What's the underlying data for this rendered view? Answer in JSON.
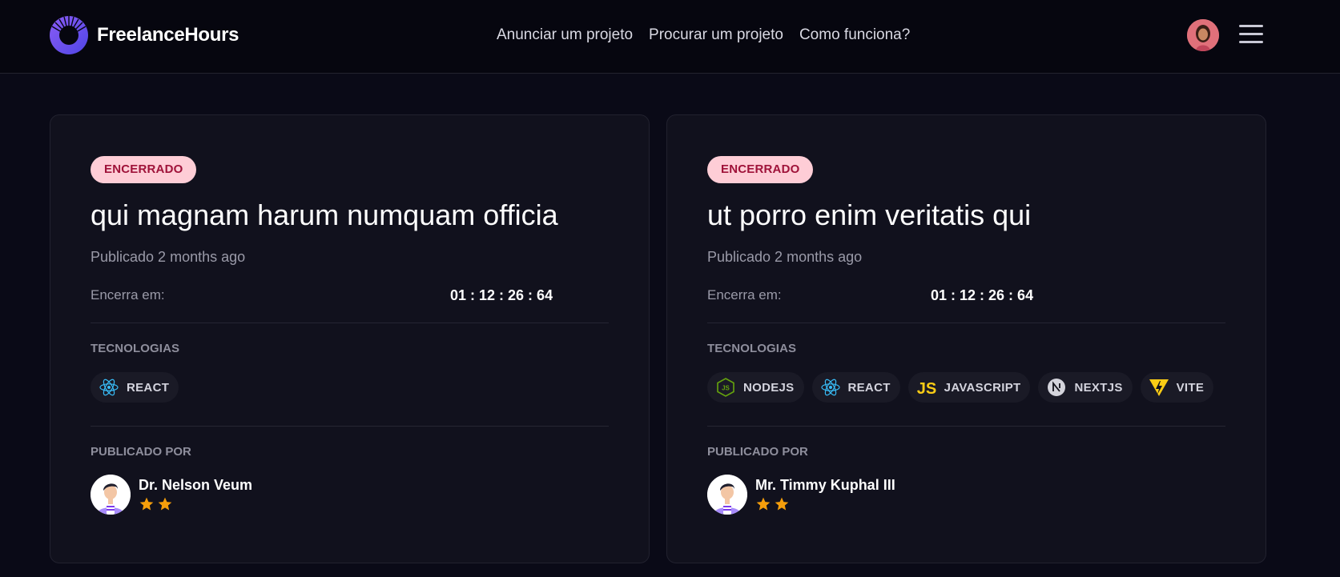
{
  "header": {
    "brand": "FreelanceHours",
    "nav": [
      {
        "label": "Anunciar um projeto"
      },
      {
        "label": "Procurar um projeto"
      },
      {
        "label": "Como funciona?"
      }
    ]
  },
  "colors": {
    "accent": "#6366f1",
    "badge_bg": "#fecdd6",
    "badge_text": "#9f1239",
    "star": "#f59e0b"
  },
  "projects": [
    {
      "status": "ENCERRADO",
      "title": "qui magnam harum numquam officia",
      "published": "Publicado 2 months ago",
      "ends_label": "Encerra em:",
      "countdown": "01 : 12 : 26 : 64",
      "tech_label": "TECNOLOGIAS",
      "techs": [
        {
          "label": "REACT",
          "icon": "react-icon"
        }
      ],
      "author_label": "PUBLICADO POR",
      "author": {
        "name": "Dr. Nelson Veum",
        "rating": 2
      }
    },
    {
      "status": "ENCERRADO",
      "title": "ut porro enim veritatis qui",
      "published": "Publicado 2 months ago",
      "ends_label": "Encerra em:",
      "countdown": "01 : 12 : 26 : 64",
      "tech_label": "TECNOLOGIAS",
      "techs": [
        {
          "label": "NODEJS",
          "icon": "nodejs-icon"
        },
        {
          "label": "REACT",
          "icon": "react-icon"
        },
        {
          "label": "JAVASCRIPT",
          "icon": "javascript-icon"
        },
        {
          "label": "NEXTJS",
          "icon": "nextjs-icon"
        },
        {
          "label": "VITE",
          "icon": "vite-icon"
        }
      ],
      "author_label": "PUBLICADO POR",
      "author": {
        "name": "Mr. Timmy Kuphal III",
        "rating": 2
      }
    }
  ]
}
